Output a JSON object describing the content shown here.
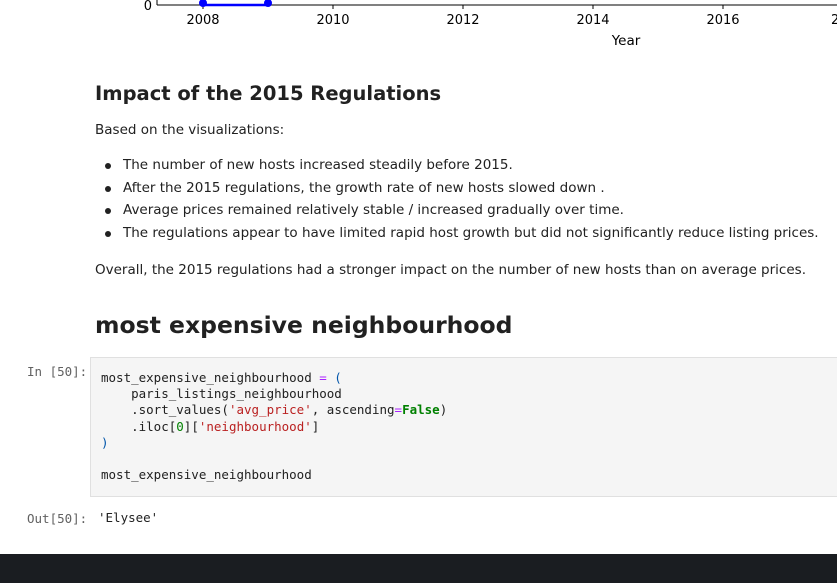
{
  "chart_data": {
    "type": "line",
    "x_ticks": [
      "2008",
      "2010",
      "2012",
      "2014",
      "2016",
      "2"
    ],
    "y_ticks": [
      "0"
    ],
    "xlabel": "Year",
    "series": [
      {
        "x": [
          2008,
          2009
        ],
        "y": [
          0,
          0
        ]
      }
    ],
    "line_color": "#0000ff"
  },
  "markdown": {
    "heading": "Impact of the 2015 Regulations",
    "intro": "Based on the visualizations:",
    "bullets": [
      "The number of new hosts increased steadily before 2015.",
      "After the 2015 regulations, the growth rate of new hosts slowed down .",
      "Average prices remained relatively stable / increased gradually over time.",
      "The regulations appear to have limited rapid host growth but did not significantly reduce listing prices."
    ],
    "conclusion": "Overall, the 2015 regulations had a stronger impact on the number of new hosts than on average prices.",
    "heading2": "most expensive neighbourhood"
  },
  "cell": {
    "in_prompt": "In [50]:",
    "out_prompt": "Out[50]:",
    "code": {
      "var": "most_expensive_neighbourhood",
      "assign": " = ",
      "open_paren": "(",
      "df": "paris_listings_neighbourhood",
      "sort_method": ".sort_values(",
      "sort_col": "'avg_price'",
      "comma_asc": ", ascending",
      "eq": "=",
      "false_kw": "False",
      "close_paren": ")",
      "iloc": ".iloc[",
      "zero": "0",
      "bracket_mid": "][",
      "col": "'neighbourhood'",
      "bracket_end": "]",
      "final_line": "most_expensive_neighbourhood"
    },
    "output": "'Elysee'"
  }
}
